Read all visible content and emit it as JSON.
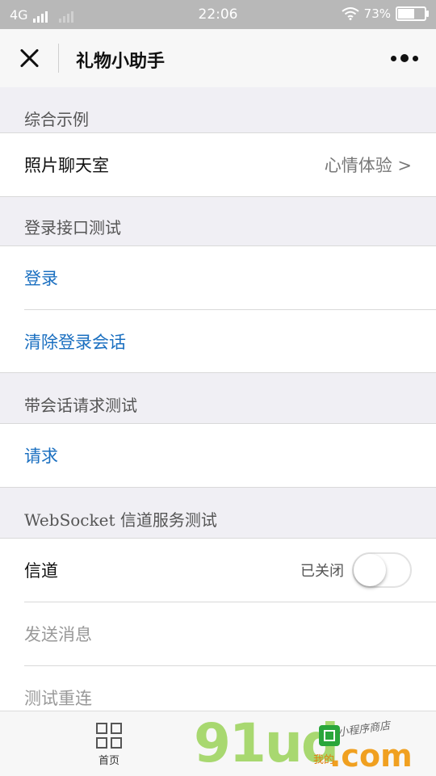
{
  "status_bar": {
    "network": "4G",
    "time": "22:06",
    "battery_percent": "73%",
    "battery_level": 0.73
  },
  "nav": {
    "title": "礼物小助手"
  },
  "sections": {
    "s1": {
      "header": "综合示例",
      "row1": {
        "label": "照片聊天室",
        "value": "心情体验 >"
      }
    },
    "s2": {
      "header": "登录接口测试",
      "row1": {
        "label": "登录"
      },
      "row2": {
        "label": "清除登录会话"
      }
    },
    "s3": {
      "header": "带会话请求测试",
      "row1": {
        "label": "请求"
      }
    },
    "s4": {
      "header": "WebSocket 信道服务测试",
      "row1": {
        "label": "信道",
        "status": "已关闭",
        "toggle_on": false
      },
      "row2": {
        "label": "发送消息"
      },
      "row3": {
        "label": "测试重连"
      }
    }
  },
  "tabbar": {
    "home_label": "首页"
  },
  "watermark": {
    "main": "91ud",
    "tld": ".com",
    "subtitle": "小程序商店",
    "me": "我的"
  },
  "colors": {
    "link_blue": "#1a6fc0",
    "status_bar": "#b8b8b8",
    "page_bg": "#f0eff4"
  },
  "icons": {
    "close": "close-icon",
    "more": "more-dots-icon",
    "home": "grid-home-icon",
    "wifi": "wifi-icon",
    "battery": "battery-icon"
  }
}
